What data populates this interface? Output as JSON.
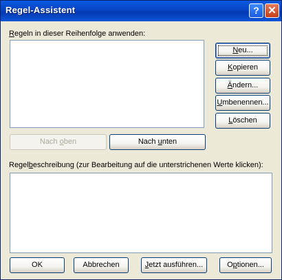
{
  "window": {
    "title": "Regel-Assistent",
    "help_icon": "?",
    "close_icon": "✕"
  },
  "rules_section": {
    "label_pre": "",
    "label_accel": "R",
    "label_post": "egeln in dieser Reihenfolge anwenden:",
    "rules": []
  },
  "side_buttons": {
    "new": {
      "pre": "",
      "accel": "N",
      "post": "eu..."
    },
    "copy": {
      "pre": "",
      "accel": "K",
      "post": "opieren"
    },
    "change": {
      "pre": "",
      "accel": "Ä",
      "post": "ndern..."
    },
    "rename": {
      "pre": "",
      "accel": "U",
      "post": "mbenennen..."
    },
    "delete": {
      "pre": "",
      "accel": "L",
      "post": "öschen"
    }
  },
  "order_buttons": {
    "up": {
      "pre": "Nach ",
      "accel": "o",
      "post": "ben"
    },
    "down": {
      "pre": "Nach ",
      "accel": "u",
      "post": "nten"
    }
  },
  "description_section": {
    "label_pre": "Regel",
    "label_accel": "b",
    "label_post": "eschreibung (zur Bearbeitung auf die unterstrichenen Werte klicken):"
  },
  "bottom_buttons": {
    "ok": {
      "pre": "OK",
      "accel": "",
      "post": ""
    },
    "cancel": {
      "pre": "Abbrechen",
      "accel": "",
      "post": ""
    },
    "run_now": {
      "pre": "",
      "accel": "J",
      "post": "etzt ausführen..."
    },
    "options": {
      "pre": "O",
      "accel": "p",
      "post": "tionen..."
    }
  }
}
